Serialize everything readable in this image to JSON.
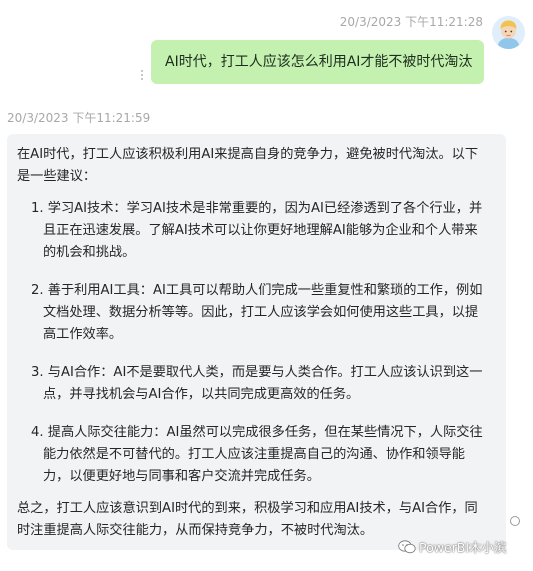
{
  "user_message": {
    "timestamp": "20/3/2023 下午11:21:28",
    "text": "AI时代，打工人应该怎么利用AI才能不被时代淘汰",
    "avatar_icon": "user-avatar-icon"
  },
  "bot_message": {
    "timestamp": "20/3/2023 下午11:21:59",
    "intro": "在AI时代，打工人应该积极利用AI来提高自身的竞争力，避免被时代淘汰。以下是一些建议：",
    "items": [
      {
        "label": "1. 学习AI技术：学习AI技术是非常重要的，因为AI已经渗透到了各个行业，并且正在迅速发展。了解AI技术可以让你更好地理解AI能够为企业和个人带来的机会和挑战。"
      },
      {
        "label": "2. 善于利用AI工具：AI工具可以帮助人们完成一些重复性和繁琐的工作，例如文档处理、数据分析等等。因此，打工人应该学会如何使用这些工具，以提高工作效率。"
      },
      {
        "label": "3. 与AI合作：AI不是要取代人类，而是要与人类合作。打工人应该认识到这一点，并寻找机会与AI合作，以共同完成更高效的任务。"
      },
      {
        "label": "4. 提高人际交往能力：AI虽然可以完成很多任务，但在某些情况下，人际交往能力依然是不可替代的。打工人应该注重提高自己的沟通、协作和领导能力，以便更好地与同事和客户交流并完成任务。"
      }
    ],
    "outro": "总之，打工人应该意识到AI时代的到来，积极学习和应用AI技术，与AI合作，同时注重提高人际交往能力，从而保持竞争力，不被时代淘汰。"
  },
  "watermark": {
    "text": "PowerBI木小滨",
    "icon": "wechat-icon"
  },
  "colors": {
    "user_bubble": "#c4f1b0",
    "bot_bubble": "#f2f3f5",
    "timestamp": "#a8a8a8"
  }
}
